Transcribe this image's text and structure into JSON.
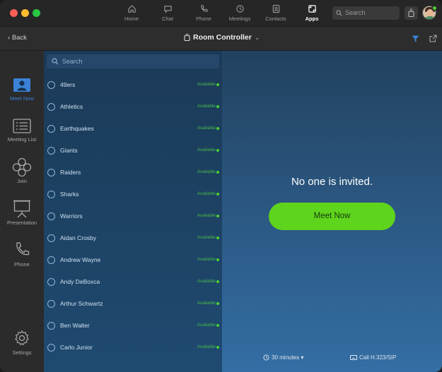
{
  "nav": {
    "tabs": [
      {
        "label": "Home",
        "icon": "home-icon"
      },
      {
        "label": "Chat",
        "icon": "chat-icon"
      },
      {
        "label": "Phone",
        "icon": "phone-icon"
      },
      {
        "label": "Meetings",
        "icon": "clock-icon"
      },
      {
        "label": "Contacts",
        "icon": "contacts-icon"
      },
      {
        "label": "Apps",
        "icon": "apps-icon"
      }
    ],
    "active_tab": "Apps",
    "search_placeholder": "Search"
  },
  "subheader": {
    "back_label": "Back",
    "title": "Room Controller",
    "chevron": "⌄"
  },
  "sidebar": {
    "items": [
      {
        "label": "Meet Now",
        "icon": "person-screen-icon"
      },
      {
        "label": "Meeting List",
        "icon": "list-icon"
      },
      {
        "label": "Join",
        "icon": "join-icon"
      },
      {
        "label": "Presentation",
        "icon": "presentation-icon"
      },
      {
        "label": "Phone",
        "icon": "phone-icon"
      },
      {
        "label": "Settings",
        "icon": "gear-icon"
      }
    ],
    "active": "Meet Now"
  },
  "list": {
    "search_placeholder": "Search",
    "rows": [
      {
        "name": "49ers",
        "status": "Available"
      },
      {
        "name": "Athletics",
        "status": "Available"
      },
      {
        "name": "Earthquakes",
        "status": "Available"
      },
      {
        "name": "Giants",
        "status": "Available"
      },
      {
        "name": "Raiders",
        "status": "Available"
      },
      {
        "name": "Sharks",
        "status": "Available"
      },
      {
        "name": "Warriors",
        "status": "Available"
      },
      {
        "name": "Aidan Crosby",
        "status": "Available"
      },
      {
        "name": "Andrew Wayne",
        "status": "Available"
      },
      {
        "name": "Andy DeBoxca",
        "status": "Available"
      },
      {
        "name": "Arthur Schwartz",
        "status": "Available"
      },
      {
        "name": "Ben Walter",
        "status": "Available"
      },
      {
        "name": "Carlo Junior",
        "status": "Available"
      }
    ]
  },
  "main": {
    "empty_message": "No one is invited.",
    "meet_now_label": "Meet Now",
    "duration_label": "30 minutes",
    "duration_caret": "▾",
    "call_label": "Call H.323/SIP"
  },
  "colors": {
    "accent_blue": "#3b82d6",
    "meet_green": "#5fd41c",
    "available_green": "#47b84a"
  }
}
